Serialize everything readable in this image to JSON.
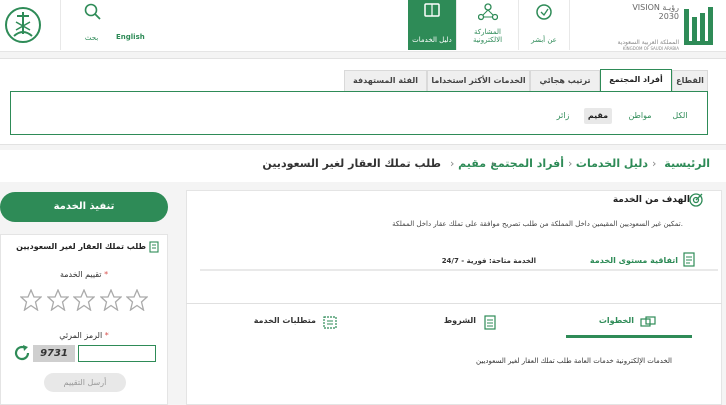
{
  "header": {
    "logo_text": "VISION رؤيـة 2030",
    "logo_sub": "المملكة العربية السعودية",
    "logo_sub_en": "KINGDOM OF SAUDI ARABIA",
    "nav": [
      {
        "label": "عن أبشر"
      },
      {
        "label": "المشاركة\nالالكترونية"
      },
      {
        "label": "دليل الخدمات"
      },
      {
        "label": "بحث"
      }
    ],
    "language": "English"
  },
  "tabs": [
    "القطاع",
    "أفراد المجتمع",
    "ترتيب هجائي",
    "الخدمات الأكثر استخداما",
    "الفئة المستهدفة"
  ],
  "filter_options": [
    "الكل",
    "مواطن",
    "مقيم",
    "زائر"
  ],
  "breadcrumb": {
    "home": "الرئيسية",
    "services": "دليل الخدمات",
    "community": "أفراد المجتمع",
    "resident": "مقيم",
    "current": "طلب تملك العقار لغير السعوديين"
  },
  "main": {
    "goal_title": "الهدف من الخدمة",
    "goal_text": "تمكين غير السعوديين المقيمين داخل المملكة من طلب تصريح موافقة على تملك عقار داخل المملكة.",
    "sla_label": "اتفاقية مستوى الخدمة",
    "availability": "الخدمة متاحة: فورية - 24/7",
    "tabs": [
      "الخطوات",
      "الشروط",
      "متطلبات الخدمة"
    ],
    "steps_desc": "الخدمات الإلكترونية خدمات العامة طلب تملك العقار لغير السعوديين"
  },
  "sidebar": {
    "execute_button": "تنفيذ الخدمة",
    "title": "طلب تملك العقار لغير السعوديين",
    "rating_label": "تقييم الخدمة",
    "code_label": "الرمز المرئي",
    "captcha": "9731",
    "send_button": "أرسل التقييم"
  },
  "colors": {
    "accent": "#2e8b57"
  }
}
